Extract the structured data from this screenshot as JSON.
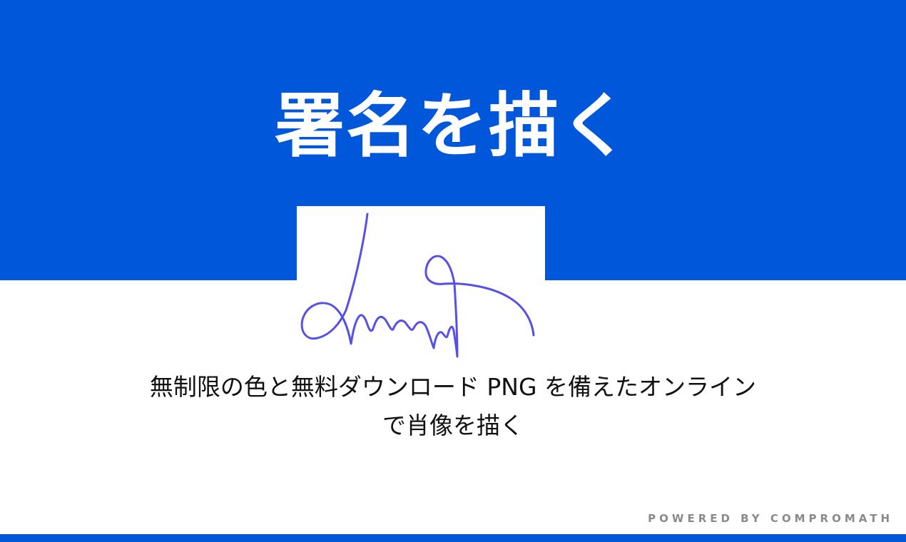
{
  "hero": {
    "title": "署名を描く",
    "background_color": "#0057da",
    "title_color": "#ffffff"
  },
  "signature_sample": {
    "ink_color": "#5650e6",
    "card_color": "#ffffff"
  },
  "description": {
    "line1": "無制限の色と無料ダウンロード PNG を備えたオンライン",
    "line2": "で肖像を描く",
    "text_color": "#111111"
  },
  "footer": {
    "powered_by": "POWERED BY COMPROMATH",
    "text_color": "#8a8a8a",
    "bar_color": "#0057da"
  }
}
